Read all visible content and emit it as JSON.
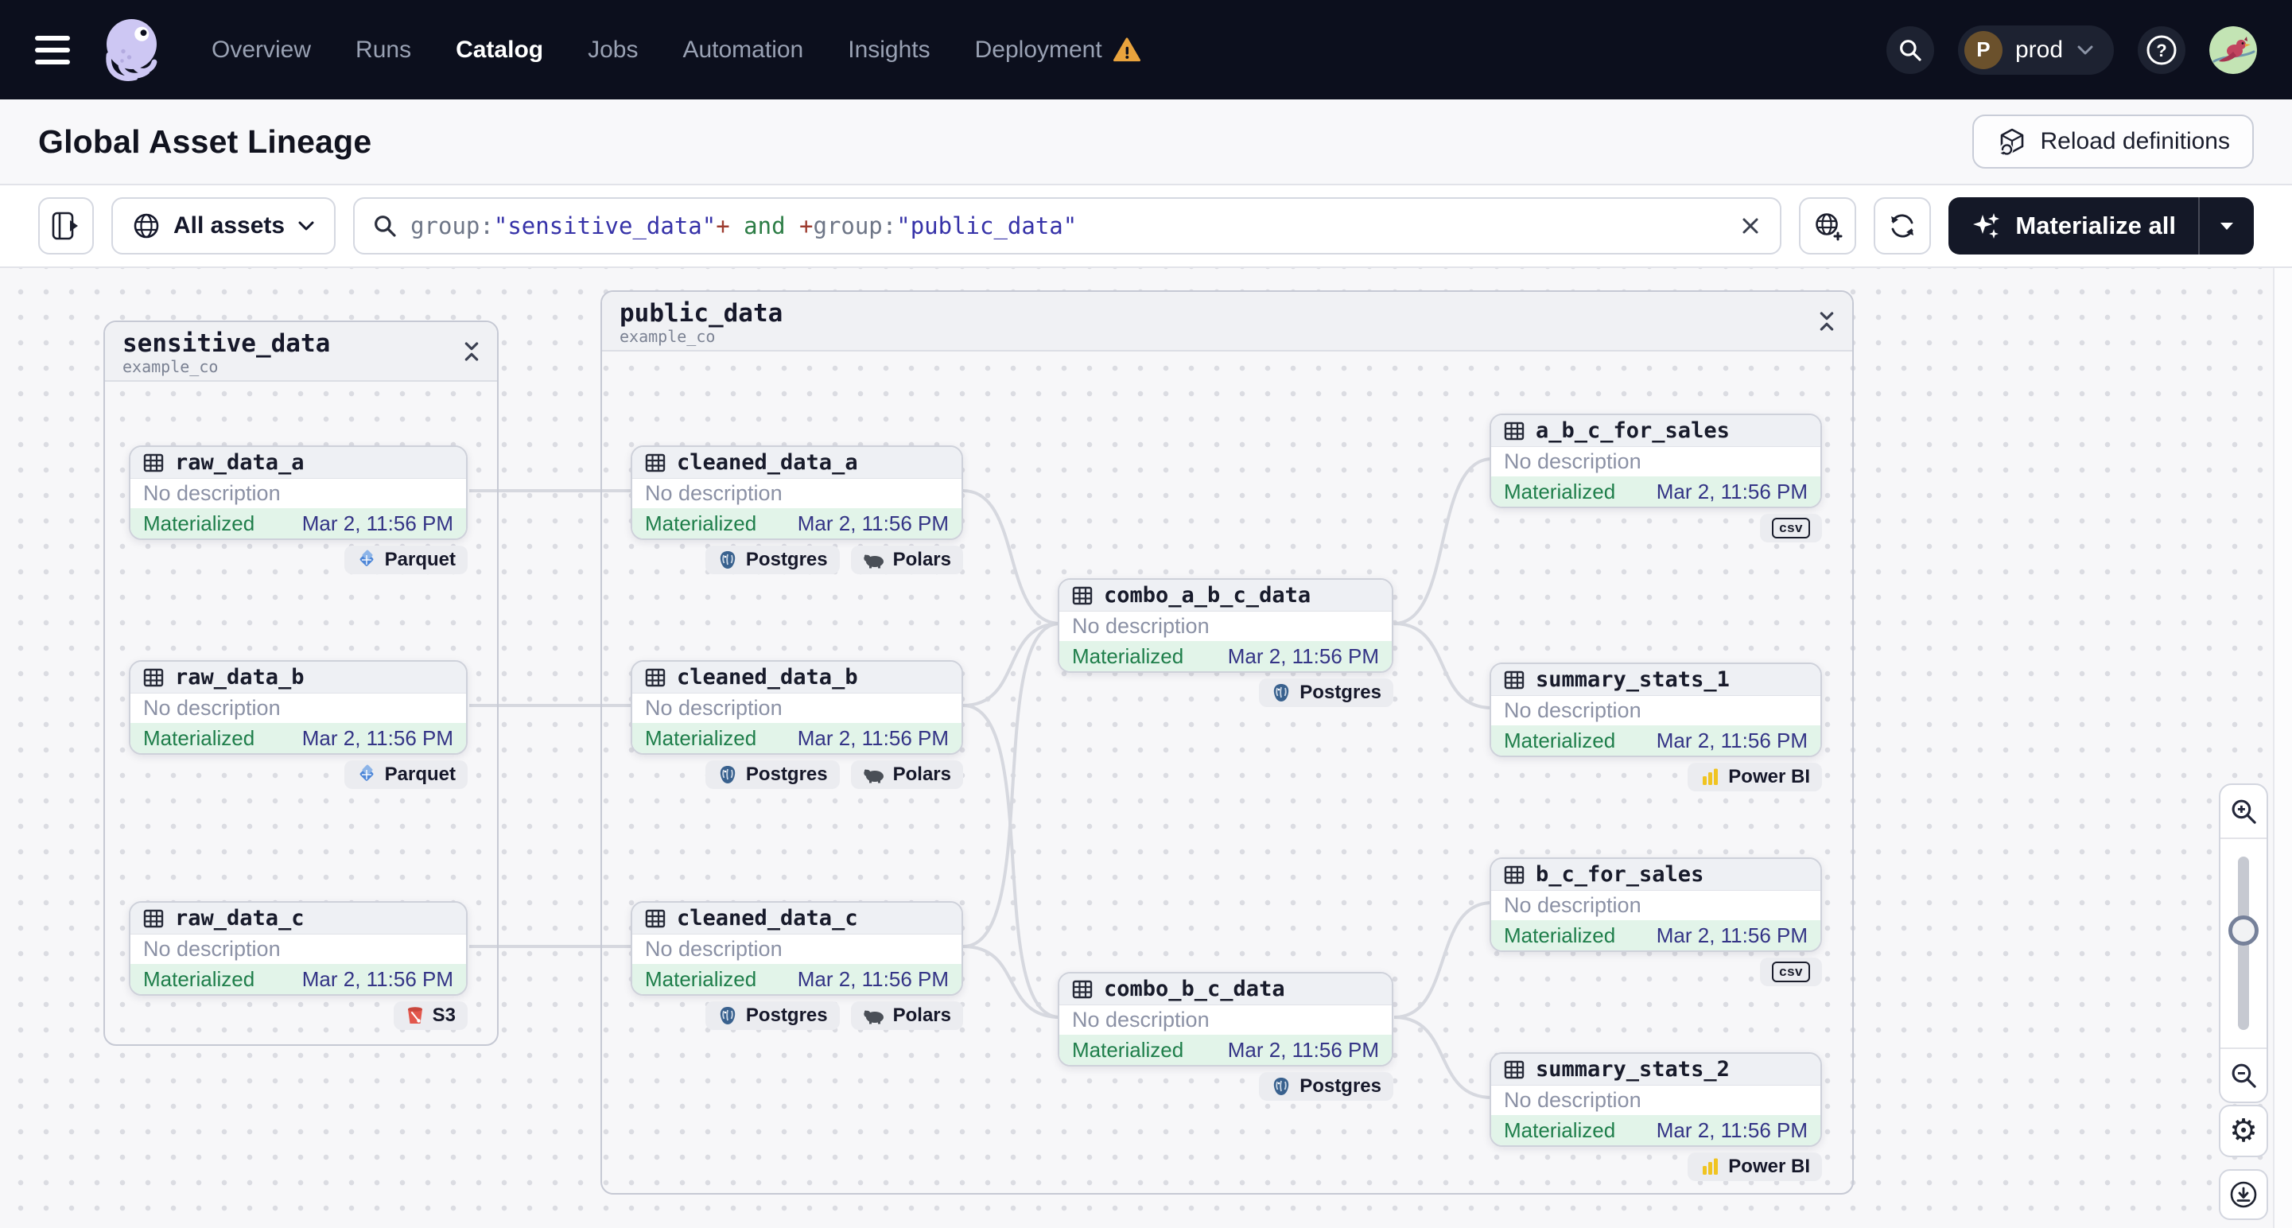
{
  "nav": {
    "items": [
      {
        "label": "Overview",
        "active": false
      },
      {
        "label": "Runs",
        "active": false
      },
      {
        "label": "Catalog",
        "active": true
      },
      {
        "label": "Jobs",
        "active": false
      },
      {
        "label": "Automation",
        "active": false
      },
      {
        "label": "Insights",
        "active": false
      },
      {
        "label": "Deployment",
        "active": false,
        "warning": true
      }
    ],
    "env": {
      "initial": "P",
      "name": "prod"
    }
  },
  "header": {
    "title": "Global Asset Lineage",
    "reload_label": "Reload definitions"
  },
  "toolbar": {
    "filter_label": "All assets",
    "materialize_label": "Materialize all",
    "query": {
      "segments": [
        {
          "text": "group:",
          "color": "#6e7687"
        },
        {
          "text": "\"sensitive_data\"",
          "color": "#3632a8"
        },
        {
          "text": "+",
          "color": "#9d3b2f"
        },
        {
          "text": " and ",
          "color": "#2d7d46"
        },
        {
          "text": "+",
          "color": "#9d3b2f"
        },
        {
          "text": "group:",
          "color": "#6e7687"
        },
        {
          "text": "\"public_data\"",
          "color": "#3632a8"
        }
      ]
    }
  },
  "canvas": {
    "groups": [
      {
        "name": "sensitive_data",
        "subtitle": "example_co",
        "nodes": [
          {
            "name": "raw_data_a",
            "description": "No description",
            "status": "Materialized",
            "timestamp": "Mar 2, 11:56 PM",
            "tags": [
              {
                "label": "Parquet",
                "icon": "parquet-icon"
              }
            ]
          },
          {
            "name": "raw_data_b",
            "description": "No description",
            "status": "Materialized",
            "timestamp": "Mar 2, 11:56 PM",
            "tags": [
              {
                "label": "Parquet",
                "icon": "parquet-icon"
              }
            ]
          },
          {
            "name": "raw_data_c",
            "description": "No description",
            "status": "Materialized",
            "timestamp": "Mar 2, 11:56 PM",
            "tags": [
              {
                "label": "S3",
                "icon": "s3-icon"
              }
            ]
          }
        ]
      },
      {
        "name": "public_data",
        "subtitle": "example_co",
        "nodes": [
          {
            "name": "cleaned_data_a",
            "description": "No description",
            "status": "Materialized",
            "timestamp": "Mar 2, 11:56 PM",
            "tags": [
              {
                "label": "Postgres",
                "icon": "postgres-icon"
              },
              {
                "label": "Polars",
                "icon": "polars-icon"
              }
            ]
          },
          {
            "name": "cleaned_data_b",
            "description": "No description",
            "status": "Materialized",
            "timestamp": "Mar 2, 11:56 PM",
            "tags": [
              {
                "label": "Postgres",
                "icon": "postgres-icon"
              },
              {
                "label": "Polars",
                "icon": "polars-icon"
              }
            ]
          },
          {
            "name": "cleaned_data_c",
            "description": "No description",
            "status": "Materialized",
            "timestamp": "Mar 2, 11:56 PM",
            "tags": [
              {
                "label": "Postgres",
                "icon": "postgres-icon"
              },
              {
                "label": "Polars",
                "icon": "polars-icon"
              }
            ]
          },
          {
            "name": "combo_a_b_c_data",
            "description": "No description",
            "status": "Materialized",
            "timestamp": "Mar 2, 11:56 PM",
            "tags": [
              {
                "label": "Postgres",
                "icon": "postgres-icon"
              }
            ]
          },
          {
            "name": "combo_b_c_data",
            "description": "No description",
            "status": "Materialized",
            "timestamp": "Mar 2, 11:56 PM",
            "tags": [
              {
                "label": "Postgres",
                "icon": "postgres-icon"
              }
            ]
          },
          {
            "name": "a_b_c_for_sales",
            "description": "No description",
            "status": "Materialized",
            "timestamp": "Mar 2, 11:56 PM",
            "tags": [
              {
                "label": "csv",
                "icon": "csv-icon"
              }
            ]
          },
          {
            "name": "summary_stats_1",
            "description": "No description",
            "status": "Materialized",
            "timestamp": "Mar 2, 11:56 PM",
            "tags": [
              {
                "label": "Power BI",
                "icon": "powerbi-icon"
              }
            ]
          },
          {
            "name": "b_c_for_sales",
            "description": "No description",
            "status": "Materialized",
            "timestamp": "Mar 2, 11:56 PM",
            "tags": [
              {
                "label": "csv",
                "icon": "csv-icon"
              }
            ]
          },
          {
            "name": "summary_stats_2",
            "description": "No description",
            "status": "Materialized",
            "timestamp": "Mar 2, 11:56 PM",
            "tags": [
              {
                "label": "Power BI",
                "icon": "powerbi-icon"
              }
            ]
          }
        ]
      }
    ],
    "edges": [
      {
        "from": "raw_data_a",
        "to": "cleaned_data_a"
      },
      {
        "from": "raw_data_b",
        "to": "cleaned_data_b"
      },
      {
        "from": "raw_data_c",
        "to": "cleaned_data_c"
      },
      {
        "from": "cleaned_data_a",
        "to": "combo_a_b_c_data"
      },
      {
        "from": "cleaned_data_b",
        "to": "combo_a_b_c_data"
      },
      {
        "from": "cleaned_data_c",
        "to": "combo_a_b_c_data"
      },
      {
        "from": "cleaned_data_b",
        "to": "combo_b_c_data"
      },
      {
        "from": "cleaned_data_c",
        "to": "combo_b_c_data"
      },
      {
        "from": "combo_a_b_c_data",
        "to": "a_b_c_for_sales"
      },
      {
        "from": "combo_a_b_c_data",
        "to": "summary_stats_1"
      },
      {
        "from": "combo_b_c_data",
        "to": "b_c_for_sales"
      },
      {
        "from": "combo_b_c_data",
        "to": "summary_stats_2"
      }
    ]
  },
  "colors": {
    "nav_bg": "#0c0f1d",
    "accent_dark": "#141827",
    "status_green": "#1e7e4a",
    "status_green_bg": "#e2f4e9",
    "timestamp_navy": "#343486",
    "warning_orange": "#e9a33d",
    "edge_gray": "#d6d8df",
    "powerbi_yellow": "#f0c421",
    "s3_red": "#e2574c",
    "parquet_blue": "#4d86d8",
    "postgres_blue": "#39618e"
  }
}
